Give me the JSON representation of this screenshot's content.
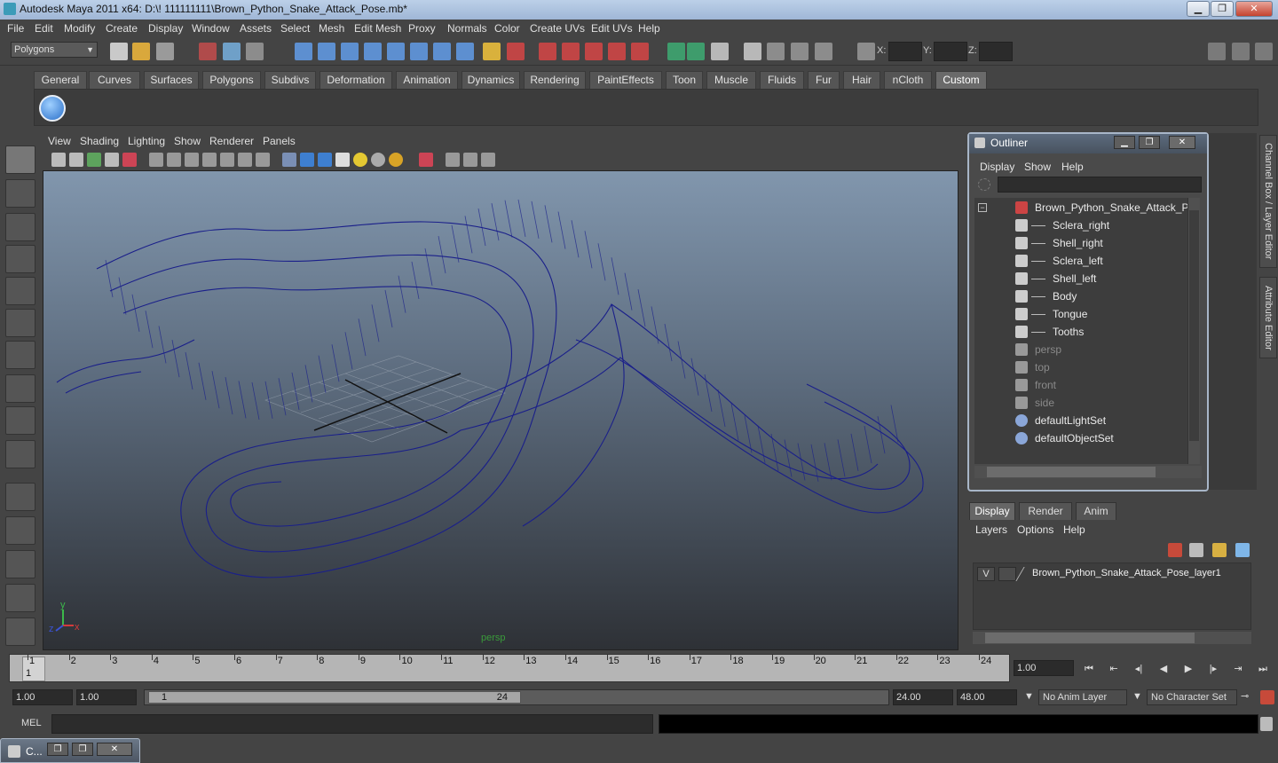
{
  "window": {
    "title": "Autodesk Maya 2011 x64: D:\\! 111111111\\Brown_Python_Snake_Attack_Pose.mb*",
    "minimize": "▁",
    "restore": "❐",
    "close": "✕"
  },
  "menu": [
    "File",
    "Edit",
    "Modify",
    "Create",
    "Display",
    "Window",
    "Assets",
    "Select",
    "Mesh",
    "Edit Mesh",
    "Proxy",
    "Normals",
    "Color",
    "Create UVs",
    "Edit UVs",
    "Help"
  ],
  "status_line": {
    "mode": "Polygons",
    "x_label": "X:",
    "y_label": "Y:",
    "z_label": "Z:"
  },
  "shelf": {
    "tabs": [
      "General",
      "Curves",
      "Surfaces",
      "Polygons",
      "Subdivs",
      "Deformation",
      "Animation",
      "Dynamics",
      "Rendering",
      "PaintEffects",
      "Toon",
      "Muscle",
      "Fluids",
      "Fur",
      "Hair",
      "nCloth",
      "Custom"
    ],
    "active_tab": "Custom"
  },
  "viewport": {
    "menu": [
      "View",
      "Shading",
      "Lighting",
      "Show",
      "Renderer",
      "Panels"
    ],
    "camera_label": "persp",
    "axis_y": "y",
    "axis_x": "x",
    "axis_z": "z",
    "wire_color": "#1a1f8a"
  },
  "outliner": {
    "title": "Outliner",
    "menu": [
      "Display",
      "Show",
      "Help"
    ],
    "collapse": "−",
    "items": [
      {
        "label": "Brown_Python_Snake_Attack_Pos",
        "indent": 0,
        "dim": false,
        "icon": "mesh-group-icon"
      },
      {
        "label": "Sclera_right",
        "indent": 1,
        "dim": false,
        "icon": "mesh-icon"
      },
      {
        "label": "Shell_right",
        "indent": 1,
        "dim": false,
        "icon": "mesh-icon"
      },
      {
        "label": "Sclera_left",
        "indent": 1,
        "dim": false,
        "icon": "mesh-icon"
      },
      {
        "label": "Shell_left",
        "indent": 1,
        "dim": false,
        "icon": "mesh-icon"
      },
      {
        "label": "Body",
        "indent": 1,
        "dim": false,
        "icon": "mesh-icon"
      },
      {
        "label": "Tongue",
        "indent": 1,
        "dim": false,
        "icon": "mesh-icon"
      },
      {
        "label": "Tooths",
        "indent": 1,
        "dim": false,
        "icon": "mesh-icon"
      },
      {
        "label": "persp",
        "indent": 0,
        "dim": true,
        "icon": "camera-icon"
      },
      {
        "label": "top",
        "indent": 0,
        "dim": true,
        "icon": "camera-icon"
      },
      {
        "label": "front",
        "indent": 0,
        "dim": true,
        "icon": "camera-icon"
      },
      {
        "label": "side",
        "indent": 0,
        "dim": true,
        "icon": "camera-icon"
      },
      {
        "label": "defaultLightSet",
        "indent": 0,
        "dim": false,
        "icon": "set-icon"
      },
      {
        "label": "defaultObjectSet",
        "indent": 0,
        "dim": false,
        "icon": "set-icon"
      }
    ]
  },
  "side_tabs": {
    "channel_box": "Channel Box / Layer Editor",
    "attribute_editor": "Attribute Editor"
  },
  "layer_editor": {
    "tabs": [
      "Display",
      "Render",
      "Anim"
    ],
    "active_tab": "Display",
    "menu": [
      "Layers",
      "Options",
      "Help"
    ],
    "layers": [
      {
        "visible": "V",
        "name": "Brown_Python_Snake_Attack_Pose_layer1"
      }
    ]
  },
  "time_slider": {
    "ticks": [
      "1",
      "2",
      "3",
      "4",
      "5",
      "6",
      "7",
      "8",
      "9",
      "10",
      "11",
      "12",
      "13",
      "14",
      "15",
      "16",
      "17",
      "18",
      "19",
      "20",
      "21",
      "22",
      "23",
      "24"
    ],
    "current_frame": "1",
    "current_time": "1.00"
  },
  "playback": [
    "⏮",
    "⇤",
    "◂|",
    "◀",
    "▶",
    "|▸",
    "⇥",
    "⏭"
  ],
  "range_slider": {
    "start_time": "1.00",
    "start_range": "1.00",
    "range_start_label": "1",
    "range_end_label": "24",
    "end_range": "24.00",
    "end_time": "48.00",
    "anim_layer": "No Anim Layer",
    "character_set": "No Character Set"
  },
  "command_line": {
    "label": "MEL"
  },
  "minimized_window": {
    "label": "C..."
  }
}
